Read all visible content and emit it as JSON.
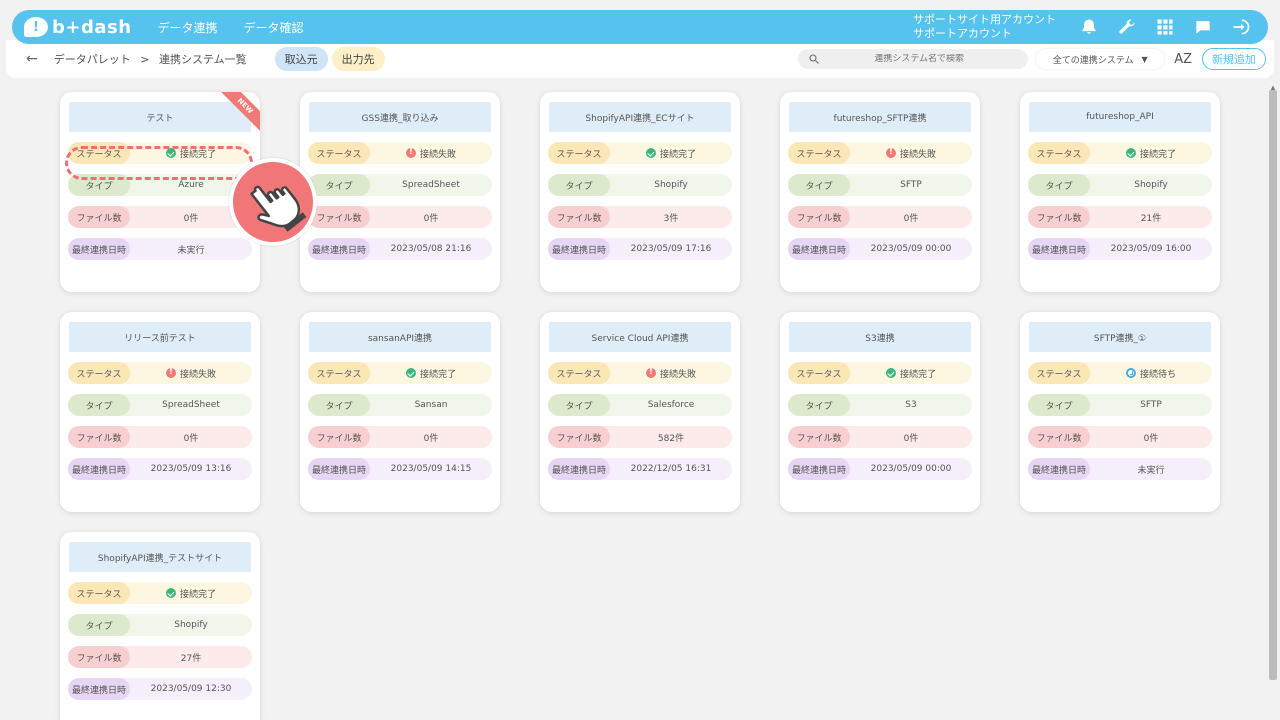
{
  "header": {
    "logo_mark": "!",
    "logo_text": "b+dash",
    "nav": [
      "データ連携",
      "データ確認"
    ],
    "account_line1": "サポートサイト用アカウント",
    "account_line2": "サポートアカウント",
    "icons": [
      "bell-icon",
      "wrench-icon",
      "grid-icon",
      "chat-icon",
      "logout-icon"
    ],
    "accent_color": "#55c3ee"
  },
  "subbar": {
    "back": "←",
    "breadcrumb_root": "データパレット",
    "breadcrumb_sep": ">",
    "breadcrumb_current": "連携システム一覧",
    "tab_import": "取込元",
    "tab_export": "出力先",
    "search_placeholder": "連携システム名で検索",
    "filter_value": "全ての連携システム",
    "sort_label": "AZ",
    "add_button": "新規追加"
  },
  "labels": {
    "status": "ステータス",
    "type": "タイプ",
    "files": "ファイル数",
    "last_sync": "最終連携日時"
  },
  "new_badge": "NEW",
  "cards": [
    {
      "title": "テスト",
      "status": "接続完了",
      "status_kind": "ok",
      "type": "Azure",
      "files": "0件",
      "last": "未実行",
      "is_new": true
    },
    {
      "title": "GSS連携_取り込み",
      "status": "接続失敗",
      "status_kind": "err",
      "type": "SpreadSheet",
      "files": "0件",
      "last": "2023/05/08 21:16"
    },
    {
      "title": "ShopifyAPI連携_ECサイト",
      "status": "接続完了",
      "status_kind": "ok",
      "type": "Shopify",
      "files": "3件",
      "last": "2023/05/09 17:16"
    },
    {
      "title": "futureshop_SFTP連携",
      "status": "接続失敗",
      "status_kind": "err",
      "type": "SFTP",
      "files": "0件",
      "last": "2023/05/09 00:00"
    },
    {
      "title": "futureshop_API",
      "status": "接続完了",
      "status_kind": "ok",
      "type": "Shopify",
      "files": "21件",
      "last": "2023/05/09 16:00"
    },
    {
      "title": "リリース前テスト",
      "status": "接続失敗",
      "status_kind": "err",
      "type": "SpreadSheet",
      "files": "0件",
      "last": "2023/05/09 13:16"
    },
    {
      "title": "sansanAPI連携",
      "status": "接続完了",
      "status_kind": "ok",
      "type": "Sansan",
      "files": "0件",
      "last": "2023/05/09 14:15"
    },
    {
      "title": "Service Cloud API連携",
      "status": "接続失敗",
      "status_kind": "err",
      "type": "Salesforce",
      "files": "582件",
      "last": "2022/12/05 16:31"
    },
    {
      "title": "S3連携",
      "status": "接続完了",
      "status_kind": "ok",
      "type": "S3",
      "files": "0件",
      "last": "2023/05/09 00:00"
    },
    {
      "title": "SFTP連携_①",
      "status": "接続待ち",
      "status_kind": "wait",
      "type": "SFTP",
      "files": "0件",
      "last": "未実行"
    },
    {
      "title": "ShopifyAPI連携_テストサイト",
      "status": "接続完了",
      "status_kind": "ok",
      "type": "Shopify",
      "files": "27件",
      "last": "2023/05/09 12:30"
    }
  ]
}
